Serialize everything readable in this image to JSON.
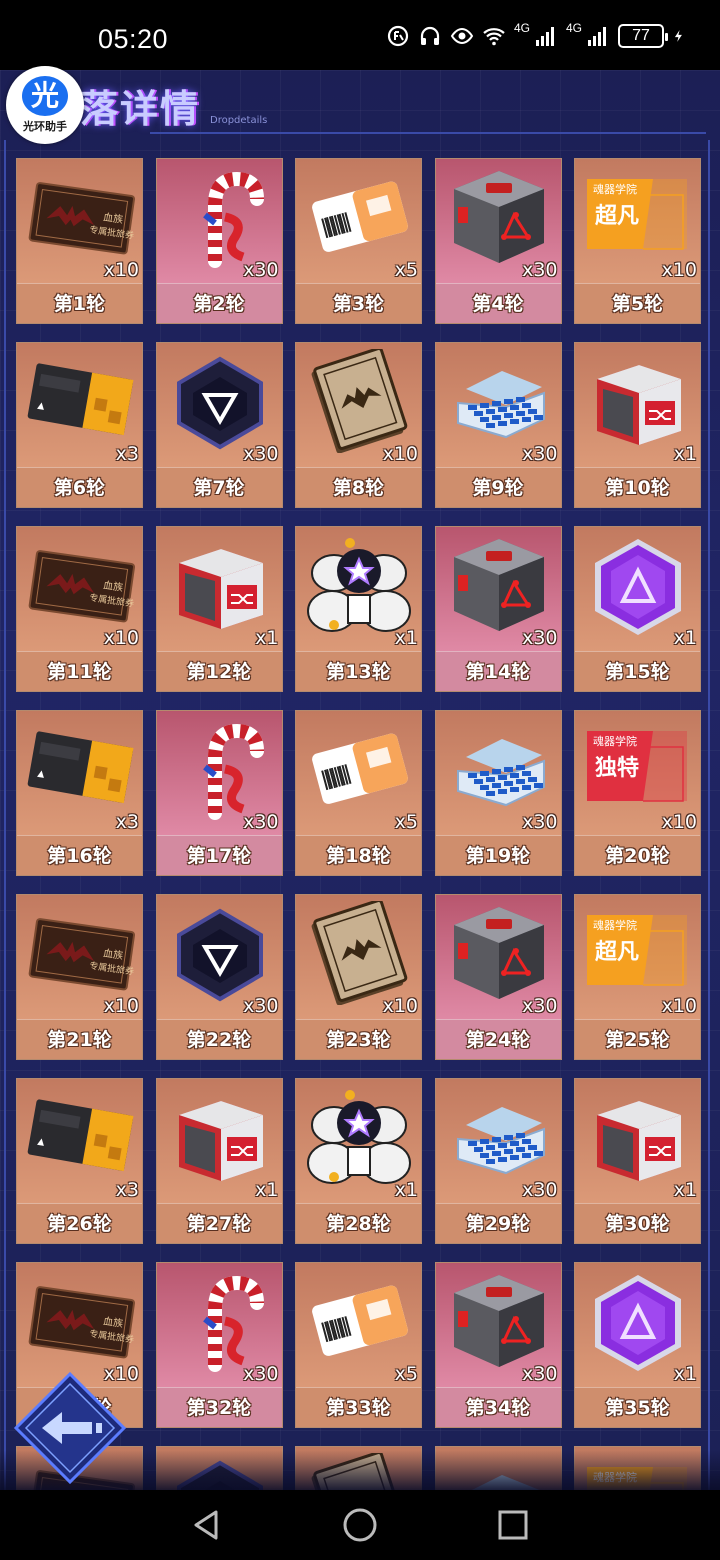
{
  "status_bar": {
    "time": "05:20",
    "battery": "77",
    "network_1": "4G",
    "network_2": "4G",
    "icons": [
      "data-saver-icon",
      "headphones-icon",
      "eye-icon",
      "wifi-icon",
      "signal-icon",
      "signal-icon",
      "battery-icon",
      "charging-icon"
    ]
  },
  "header": {
    "title": "落详情",
    "subtitle": "Dropdetails"
  },
  "logo": {
    "glyph": "光",
    "caption": "光环助手"
  },
  "rewards": [
    {
      "round": "第1轮",
      "count": "x10",
      "icon": "ticket-bat-icon",
      "bg": "orange"
    },
    {
      "round": "第2轮",
      "count": "x30",
      "icon": "candy-cane-icon",
      "bg": "pink"
    },
    {
      "round": "第3轮",
      "count": "x5",
      "icon": "barcode-card-icon",
      "bg": "orange"
    },
    {
      "round": "第4轮",
      "count": "x30",
      "icon": "grey-crate-icon",
      "bg": "pink"
    },
    {
      "round": "第5轮",
      "count": "x10",
      "icon": "ticket-orange-icon",
      "bg": "orange",
      "ticket_text": "超凡",
      "ticket_header": "魂器学院"
    },
    {
      "round": "第6轮",
      "count": "x3",
      "icon": "ticket-black-gold-icon",
      "bg": "orange"
    },
    {
      "round": "第7轮",
      "count": "x30",
      "icon": "triangle-core-icon",
      "bg": "orange"
    },
    {
      "round": "第8轮",
      "count": "x10",
      "icon": "bat-book-icon",
      "bg": "orange"
    },
    {
      "round": "第9轮",
      "count": "x30",
      "icon": "blue-case-icon",
      "bg": "orange"
    },
    {
      "round": "第10轮",
      "count": "x1",
      "icon": "red-chest-icon",
      "bg": "orange"
    },
    {
      "round": "第11轮",
      "count": "x10",
      "icon": "ticket-bat-icon",
      "bg": "orange"
    },
    {
      "round": "第12轮",
      "count": "x1",
      "icon": "red-chest-icon",
      "bg": "orange"
    },
    {
      "round": "第13轮",
      "count": "x1",
      "icon": "mecha-robot-icon",
      "bg": "orange"
    },
    {
      "round": "第14轮",
      "count": "x30",
      "icon": "grey-crate-icon",
      "bg": "pink"
    },
    {
      "round": "第15轮",
      "count": "x1",
      "icon": "purple-hex-icon",
      "bg": "orange"
    },
    {
      "round": "第16轮",
      "count": "x3",
      "icon": "ticket-black-gold-icon",
      "bg": "orange"
    },
    {
      "round": "第17轮",
      "count": "x30",
      "icon": "candy-cane-icon",
      "bg": "pink"
    },
    {
      "round": "第18轮",
      "count": "x5",
      "icon": "barcode-card-icon",
      "bg": "orange"
    },
    {
      "round": "第19轮",
      "count": "x30",
      "icon": "blue-case-icon",
      "bg": "orange"
    },
    {
      "round": "第20轮",
      "count": "x10",
      "icon": "ticket-red-icon",
      "bg": "orange",
      "ticket_text": "独特",
      "ticket_header": "魂器学院"
    },
    {
      "round": "第21轮",
      "count": "x10",
      "icon": "ticket-bat-icon",
      "bg": "orange"
    },
    {
      "round": "第22轮",
      "count": "x30",
      "icon": "triangle-core-icon",
      "bg": "orange"
    },
    {
      "round": "第23轮",
      "count": "x10",
      "icon": "bat-book-icon",
      "bg": "orange"
    },
    {
      "round": "第24轮",
      "count": "x30",
      "icon": "grey-crate-icon",
      "bg": "pink"
    },
    {
      "round": "第25轮",
      "count": "x10",
      "icon": "ticket-orange-icon",
      "bg": "orange",
      "ticket_text": "超凡",
      "ticket_header": "魂器学院"
    },
    {
      "round": "第26轮",
      "count": "x3",
      "icon": "ticket-black-gold-icon",
      "bg": "orange"
    },
    {
      "round": "第27轮",
      "count": "x1",
      "icon": "red-chest-icon",
      "bg": "orange"
    },
    {
      "round": "第28轮",
      "count": "x1",
      "icon": "mecha-robot-icon",
      "bg": "orange"
    },
    {
      "round": "第29轮",
      "count": "x30",
      "icon": "blue-case-icon",
      "bg": "orange"
    },
    {
      "round": "第30轮",
      "count": "x1",
      "icon": "red-chest-icon",
      "bg": "orange"
    },
    {
      "round": "第31轮",
      "count": "x10",
      "icon": "ticket-bat-icon",
      "bg": "orange"
    },
    {
      "round": "第32轮",
      "count": "x30",
      "icon": "candy-cane-icon",
      "bg": "pink"
    },
    {
      "round": "第33轮",
      "count": "x5",
      "icon": "barcode-card-icon",
      "bg": "orange"
    },
    {
      "round": "第34轮",
      "count": "x30",
      "icon": "grey-crate-icon",
      "bg": "pink"
    },
    {
      "round": "第35轮",
      "count": "x1",
      "icon": "purple-hex-icon",
      "bg": "orange"
    },
    {
      "round": "",
      "count": "",
      "icon": "ticket-bat-icon",
      "bg": "orange"
    },
    {
      "round": "",
      "count": "",
      "icon": "triangle-core-icon",
      "bg": "orange"
    },
    {
      "round": "",
      "count": "",
      "icon": "bat-book-icon",
      "bg": "orange"
    },
    {
      "round": "",
      "count": "",
      "icon": "blue-case-icon",
      "bg": "orange"
    },
    {
      "round": "",
      "count": "",
      "icon": "ticket-orange-icon",
      "bg": "orange",
      "ticket_header": "魂器学院"
    }
  ],
  "ticket_bat_text": "血族专属批旅券",
  "back_button_icon": "back-arrow-icon",
  "nav": {
    "back_icon": "nav-back-icon",
    "home_icon": "nav-home-icon",
    "recents_icon": "nav-recents-icon"
  },
  "colors": {
    "accent": "#c9ccff",
    "card_orange": "#d48d6c",
    "card_pink": "#d97a92",
    "bg": "#1c1f55"
  }
}
